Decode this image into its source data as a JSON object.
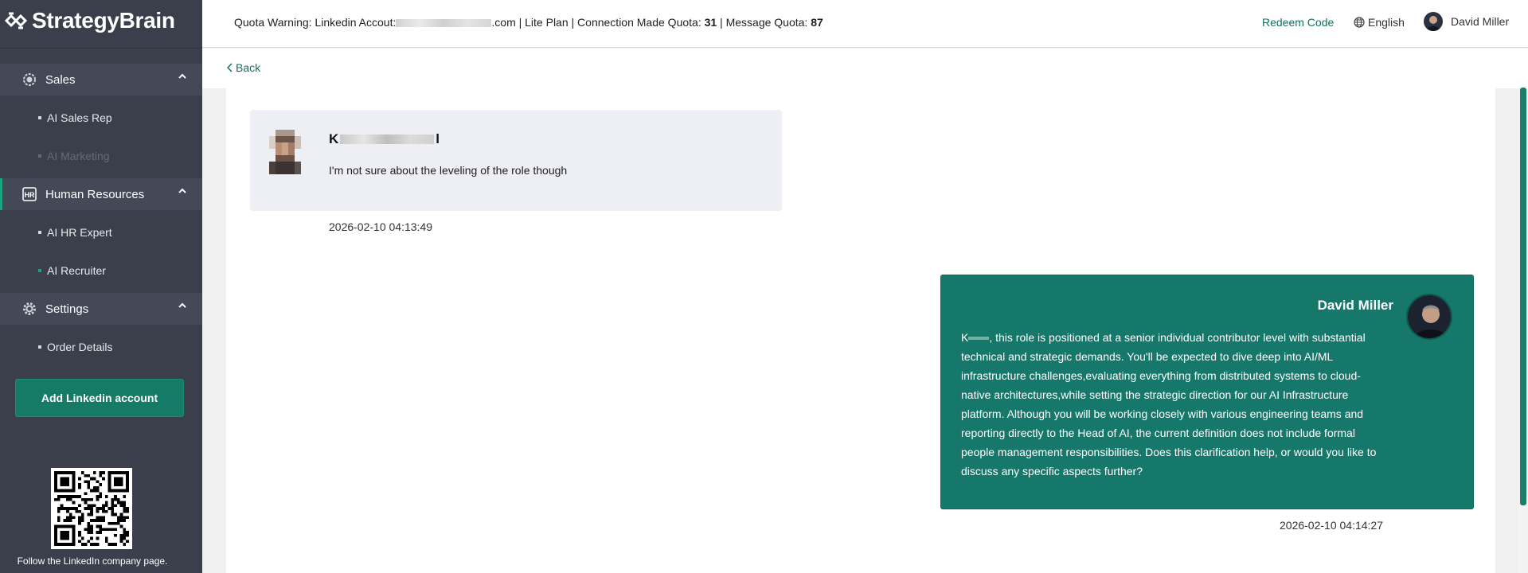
{
  "app": {
    "brand": "StrategyBrain"
  },
  "header": {
    "quota_prefix": "Quota Warning: Linkedin Accout:",
    "quota_email_suffix": ".com",
    "quota_plan": " | Lite Plan | Connection Made Quota: ",
    "connection_quota": "31",
    "quota_message_label": " | Message Quota: ",
    "message_quota": "87",
    "redeem_label": "Redeem Code",
    "language": "English",
    "user_name": "David Miller"
  },
  "sidebar": {
    "groups": [
      {
        "label": "Sales",
        "icon": "sales-badge-icon",
        "items": [
          {
            "label": "AI Sales Rep",
            "state": "normal"
          },
          {
            "label": "AI Marketing",
            "state": "disabled"
          }
        ]
      },
      {
        "label": "Human Resources",
        "icon": "hr-icon",
        "items": [
          {
            "label": "AI HR Expert",
            "state": "normal"
          },
          {
            "label": "AI Recruiter",
            "state": "selected"
          }
        ]
      },
      {
        "label": "Settings",
        "icon": "gear-icon",
        "items": [
          {
            "label": "Order Details",
            "state": "normal"
          }
        ]
      }
    ],
    "add_button": "Add Linkedin account",
    "qr_caption": "Follow the LinkedIn company page."
  },
  "nav": {
    "back_label": "Back"
  },
  "conversation": {
    "incoming": {
      "sender_first": "K",
      "sender_last": "l",
      "text": "I'm not sure about the leveling of the role though",
      "timestamp": "2026-02-10 04:13:49"
    },
    "outgoing": {
      "sender": "David Miller",
      "text_prefix": "K",
      "text": ", this role is positioned at a senior individual contributor level with substantial technical and strategic demands. You'll be expected to dive deep into AI/ML infrastructure challenges,evaluating everything from distributed systems to cloud-native architectures,while setting the strategic direction for our AI Infrastructure platform. Although you will be working closely with various engineering teams and reporting directly to the Head of AI, the current definition does not include formal people management responsibilities. Does this clarification help, or would you like to discuss any specific aspects further?",
      "timestamp": "2026-02-10 04:14:27"
    }
  },
  "colors": {
    "sidebar_bg": "#3a3f4b",
    "accent": "#15786a",
    "incoming_bubble": "#eeeef5"
  }
}
